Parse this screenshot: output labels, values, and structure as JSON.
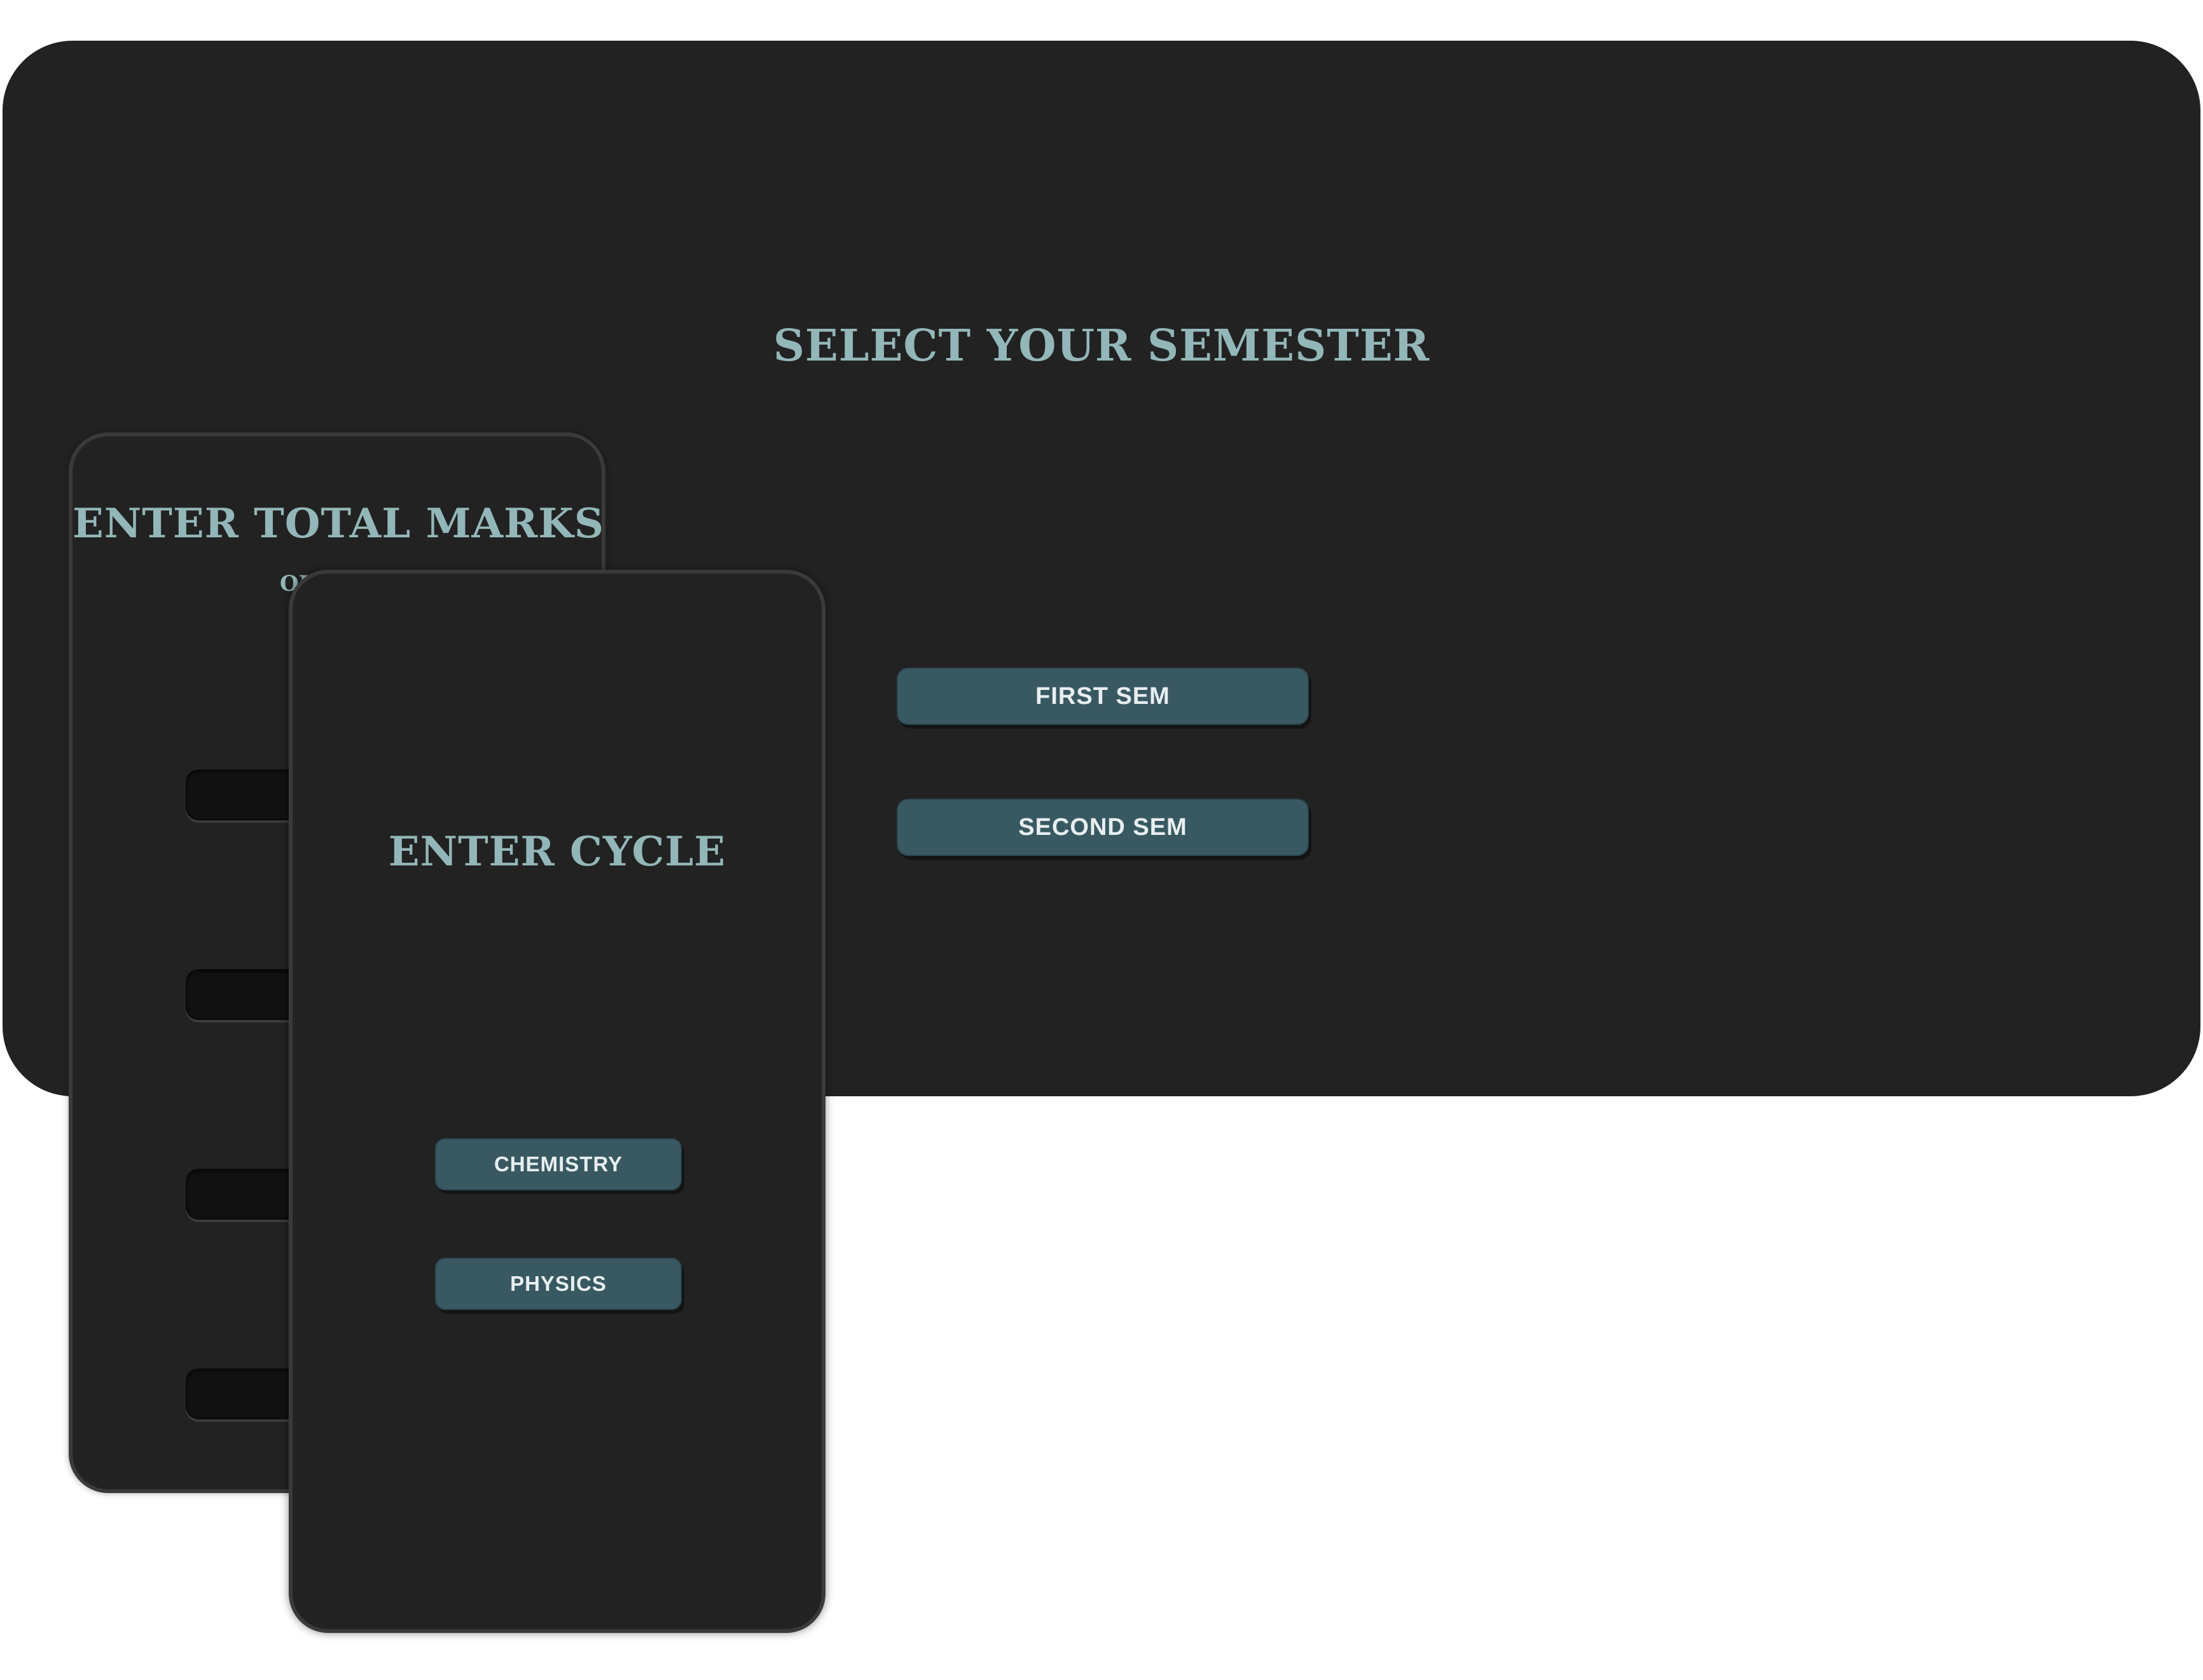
{
  "semester_panel": {
    "title": "SELECT YOUR SEMESTER",
    "buttons": [
      {
        "label": "FIRST SEM"
      },
      {
        "label": "SECOND SEM"
      }
    ]
  },
  "marks_panel": {
    "title": "ENTER TOTAL MARKS",
    "subtitle": "OI",
    "inputs": [
      {
        "value": "",
        "placeholder": ""
      },
      {
        "value": "",
        "placeholder": ""
      },
      {
        "value": "",
        "placeholder": ""
      },
      {
        "value": "",
        "placeholder": ""
      }
    ]
  },
  "cycle_panel": {
    "title": "ENTER CYCLE",
    "buttons": [
      {
        "label": "CHEMISTRY"
      },
      {
        "label": "PHYSICS"
      }
    ]
  },
  "colors": {
    "background": "#ffffff",
    "panel": "#222222",
    "panel_border": "#3a3a3a",
    "heading_text": "#93b7b8",
    "button_fill": "#395962",
    "button_text": "#e8eef0",
    "input_fill": "#111111"
  }
}
